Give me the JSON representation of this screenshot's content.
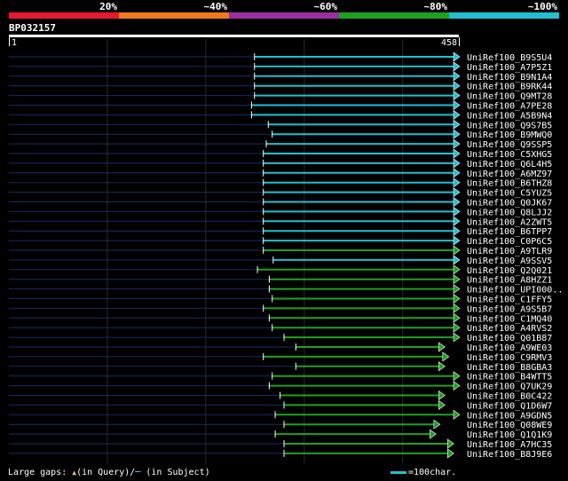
{
  "color_scale": [
    {
      "label": "20%",
      "color": "#e8182f"
    },
    {
      "label": "~40%",
      "color": "#ee7a1d"
    },
    {
      "label": "~60%",
      "color": "#9b2e9f"
    },
    {
      "label": "~80%",
      "color": "#20a020"
    },
    {
      "label": "~100%",
      "color": "#21bfcf"
    }
  ],
  "query": {
    "name": "BP032157",
    "start_label": "1",
    "end_label": "458",
    "length": 458
  },
  "hits": [
    {
      "name": "UniRef100_B9S5U4",
      "start": 250,
      "end": 458,
      "color": "#21bfcf",
      "full": true
    },
    {
      "name": "UniRef100_A7P5Z1",
      "start": 250,
      "end": 458,
      "color": "#21bfcf",
      "full": true
    },
    {
      "name": "UniRef100_B9N1A4",
      "start": 250,
      "end": 458,
      "color": "#21bfcf",
      "full": true
    },
    {
      "name": "UniRef100_B9RK44",
      "start": 250,
      "end": 458,
      "color": "#21bfcf",
      "full": true
    },
    {
      "name": "UniRef100_Q9MT28",
      "start": 250,
      "end": 458,
      "color": "#21bfcf",
      "full": true
    },
    {
      "name": "UniRef100_A7PE28",
      "start": 247,
      "end": 458,
      "color": "#21bfcf",
      "full": true
    },
    {
      "name": "UniRef100_A5B9N4",
      "start": 247,
      "end": 458,
      "color": "#21bfcf",
      "full": true
    },
    {
      "name": "UniRef100_Q9S7B5",
      "start": 264,
      "end": 458,
      "color": "#21bfcf",
      "full": true
    },
    {
      "name": "UniRef100_B9MWQ0",
      "start": 268,
      "end": 458,
      "color": "#21bfcf",
      "full": true
    },
    {
      "name": "UniRef100_Q9SSP5",
      "start": 262,
      "end": 458,
      "color": "#21bfcf",
      "full": true
    },
    {
      "name": "UniRef100_C5XHG5",
      "start": 259,
      "end": 458,
      "color": "#21bfcf",
      "full": true
    },
    {
      "name": "UniRef100_Q6L4H5",
      "start": 259,
      "end": 458,
      "color": "#21bfcf",
      "full": true
    },
    {
      "name": "UniRef100_A6MZ97",
      "start": 259,
      "end": 458,
      "color": "#21bfcf",
      "full": true
    },
    {
      "name": "UniRef100_B6THZ8",
      "start": 259,
      "end": 458,
      "color": "#21bfcf",
      "full": true
    },
    {
      "name": "UniRef100_C5YUZ5",
      "start": 259,
      "end": 458,
      "color": "#21bfcf",
      "full": true
    },
    {
      "name": "UniRef100_Q0JK67",
      "start": 259,
      "end": 458,
      "color": "#21bfcf",
      "full": true
    },
    {
      "name": "UniRef100_Q8LJJ2",
      "start": 259,
      "end": 458,
      "color": "#21bfcf",
      "full": true
    },
    {
      "name": "UniRef100_A2ZWT5",
      "start": 259,
      "end": 458,
      "color": "#21bfcf",
      "full": true
    },
    {
      "name": "UniRef100_B6TPP7",
      "start": 259,
      "end": 458,
      "color": "#21bfcf",
      "full": true
    },
    {
      "name": "UniRef100_C0P6C5",
      "start": 259,
      "end": 458,
      "color": "#21bfcf",
      "full": true
    },
    {
      "name": "UniRef100_A9TLR9",
      "start": 259,
      "end": 458,
      "color": "#20a020",
      "full": true
    },
    {
      "name": "UniRef100_A9SSV5",
      "start": 269,
      "end": 458,
      "color": "#21bfcf",
      "full": true
    },
    {
      "name": "UniRef100_Q2Q021",
      "start": 253,
      "end": 458,
      "color": "#20a020",
      "full": true
    },
    {
      "name": "UniRef100_A8HZZ1",
      "start": 265,
      "end": 458,
      "color": "#20a020",
      "full": true
    },
    {
      "name": "UniRef100_UPI000..",
      "start": 265,
      "end": 458,
      "color": "#20a020",
      "full": true
    },
    {
      "name": "UniRef100_C1FFY5",
      "start": 268,
      "end": 458,
      "color": "#20a020",
      "full": true
    },
    {
      "name": "UniRef100_A9S5B7",
      "start": 259,
      "end": 458,
      "color": "#20a020",
      "full": true
    },
    {
      "name": "UniRef100_C1MQ40",
      "start": 265,
      "end": 458,
      "color": "#20a020",
      "full": true
    },
    {
      "name": "UniRef100_A4RVS2",
      "start": 268,
      "end": 458,
      "color": "#20a020",
      "full": true
    },
    {
      "name": "UniRef100_Q01B87",
      "start": 280,
      "end": 458,
      "color": "#20a020",
      "full": true
    },
    {
      "name": "UniRef100_A9WE03",
      "start": 292,
      "end": 443,
      "color": "#20a020",
      "full": false
    },
    {
      "name": "UniRef100_C9RMV3",
      "start": 259,
      "end": 447,
      "color": "#20a020",
      "full": false
    },
    {
      "name": "UniRef100_B8GBA3",
      "start": 292,
      "end": 443,
      "color": "#20a020",
      "full": false
    },
    {
      "name": "UniRef100_B4WTT5",
      "start": 268,
      "end": 458,
      "color": "#20a020",
      "full": true
    },
    {
      "name": "UniRef100_Q7UK29",
      "start": 265,
      "end": 458,
      "color": "#20a020",
      "full": true
    },
    {
      "name": "UniRef100_B0C422",
      "start": 276,
      "end": 443,
      "color": "#20a020",
      "full": false
    },
    {
      "name": "UniRef100_Q1D6W7",
      "start": 280,
      "end": 443,
      "color": "#20a020",
      "full": false
    },
    {
      "name": "UniRef100_A9GDN5",
      "start": 271,
      "end": 458,
      "color": "#20a020",
      "full": true
    },
    {
      "name": "UniRef100_Q08WE9",
      "start": 280,
      "end": 438,
      "color": "#20a020",
      "full": false
    },
    {
      "name": "UniRef100_Q1Q1K9",
      "start": 271,
      "end": 434,
      "color": "#20a020",
      "full": false
    },
    {
      "name": "UniRef100_A7HC35",
      "start": 280,
      "end": 452,
      "color": "#20a020",
      "full": false
    },
    {
      "name": "UniRef100_B8J9E6",
      "start": 280,
      "end": 452,
      "color": "#20a020",
      "full": false
    }
  ],
  "footer": {
    "prefix": "Large gaps: ",
    "query_marker": "▲",
    "query_text": "(in Query)/",
    "subject_marker": "─",
    "subject_text": " (in Subject)",
    "key_text": "=100char."
  }
}
